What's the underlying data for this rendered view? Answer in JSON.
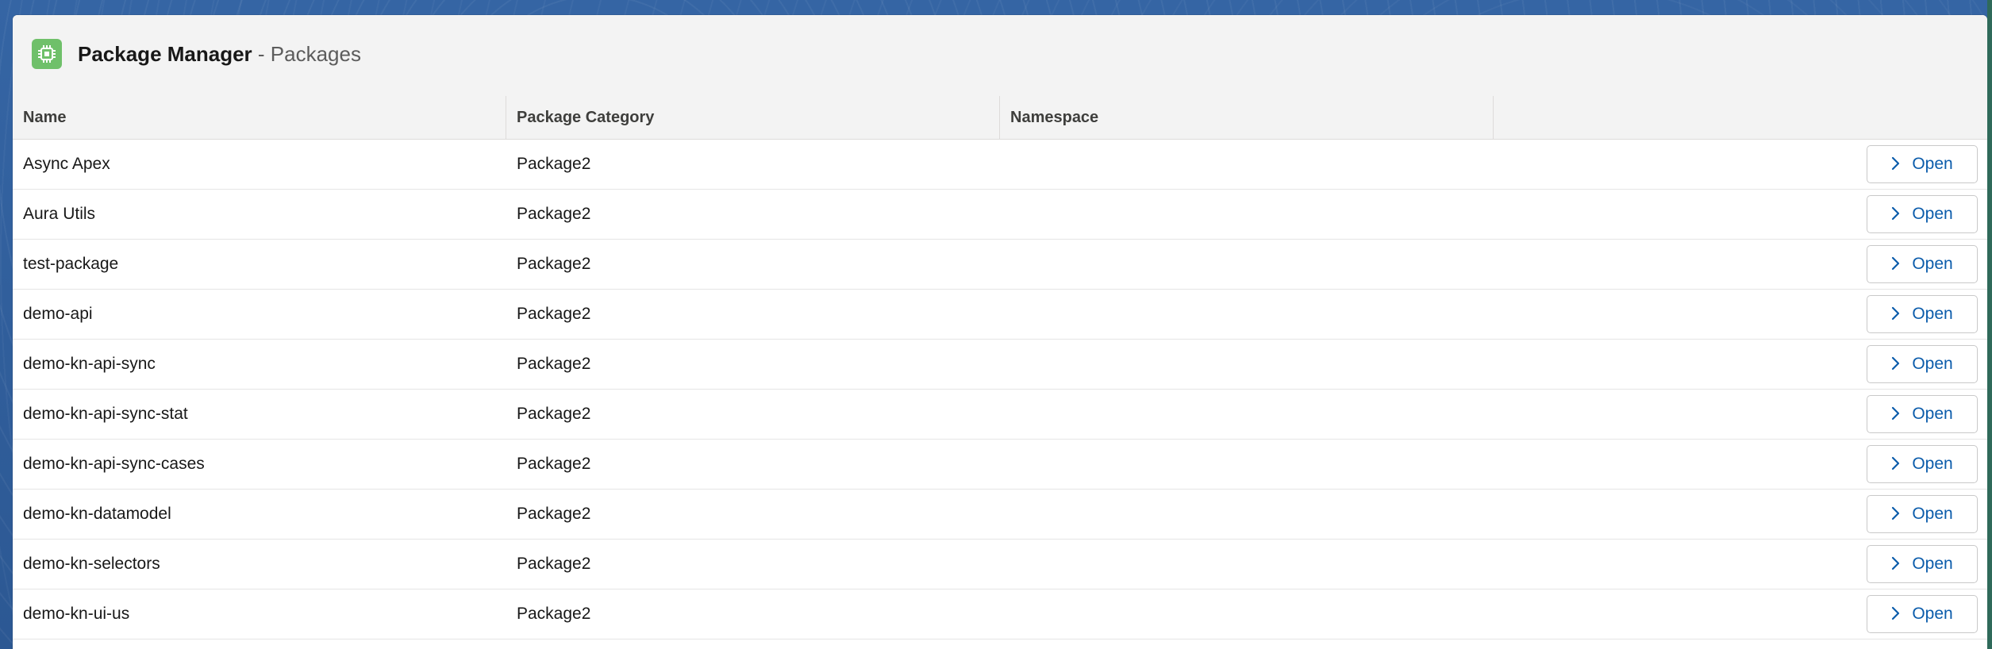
{
  "app": {
    "name": "Package Manager",
    "separator": " - ",
    "page": "Packages",
    "icon": "chip-icon",
    "icon_color": "#6fc06a"
  },
  "table": {
    "columns": [
      "Name",
      "Package Category",
      "Namespace",
      ""
    ],
    "rows": [
      {
        "name": "Async Apex",
        "category": "Package2",
        "namespace": "",
        "action": "Open"
      },
      {
        "name": "Aura Utils",
        "category": "Package2",
        "namespace": "",
        "action": "Open"
      },
      {
        "name": "test-package",
        "category": "Package2",
        "namespace": "",
        "action": "Open"
      },
      {
        "name": "demo-api",
        "category": "Package2",
        "namespace": "",
        "action": "Open"
      },
      {
        "name": "demo-kn-api-sync",
        "category": "Package2",
        "namespace": "",
        "action": "Open"
      },
      {
        "name": "demo-kn-api-sync-stat",
        "category": "Package2",
        "namespace": "",
        "action": "Open"
      },
      {
        "name": "demo-kn-api-sync-cases",
        "category": "Package2",
        "namespace": "",
        "action": "Open"
      },
      {
        "name": "demo-kn-datamodel",
        "category": "Package2",
        "namespace": "",
        "action": "Open"
      },
      {
        "name": "demo-kn-selectors",
        "category": "Package2",
        "namespace": "",
        "action": "Open"
      },
      {
        "name": "demo-kn-ui-us",
        "category": "Package2",
        "namespace": "",
        "action": "Open"
      }
    ]
  },
  "colors": {
    "accent": "#0b5cab",
    "header_bg": "#f3f3f3",
    "page_bg": "#2f5f9e"
  }
}
